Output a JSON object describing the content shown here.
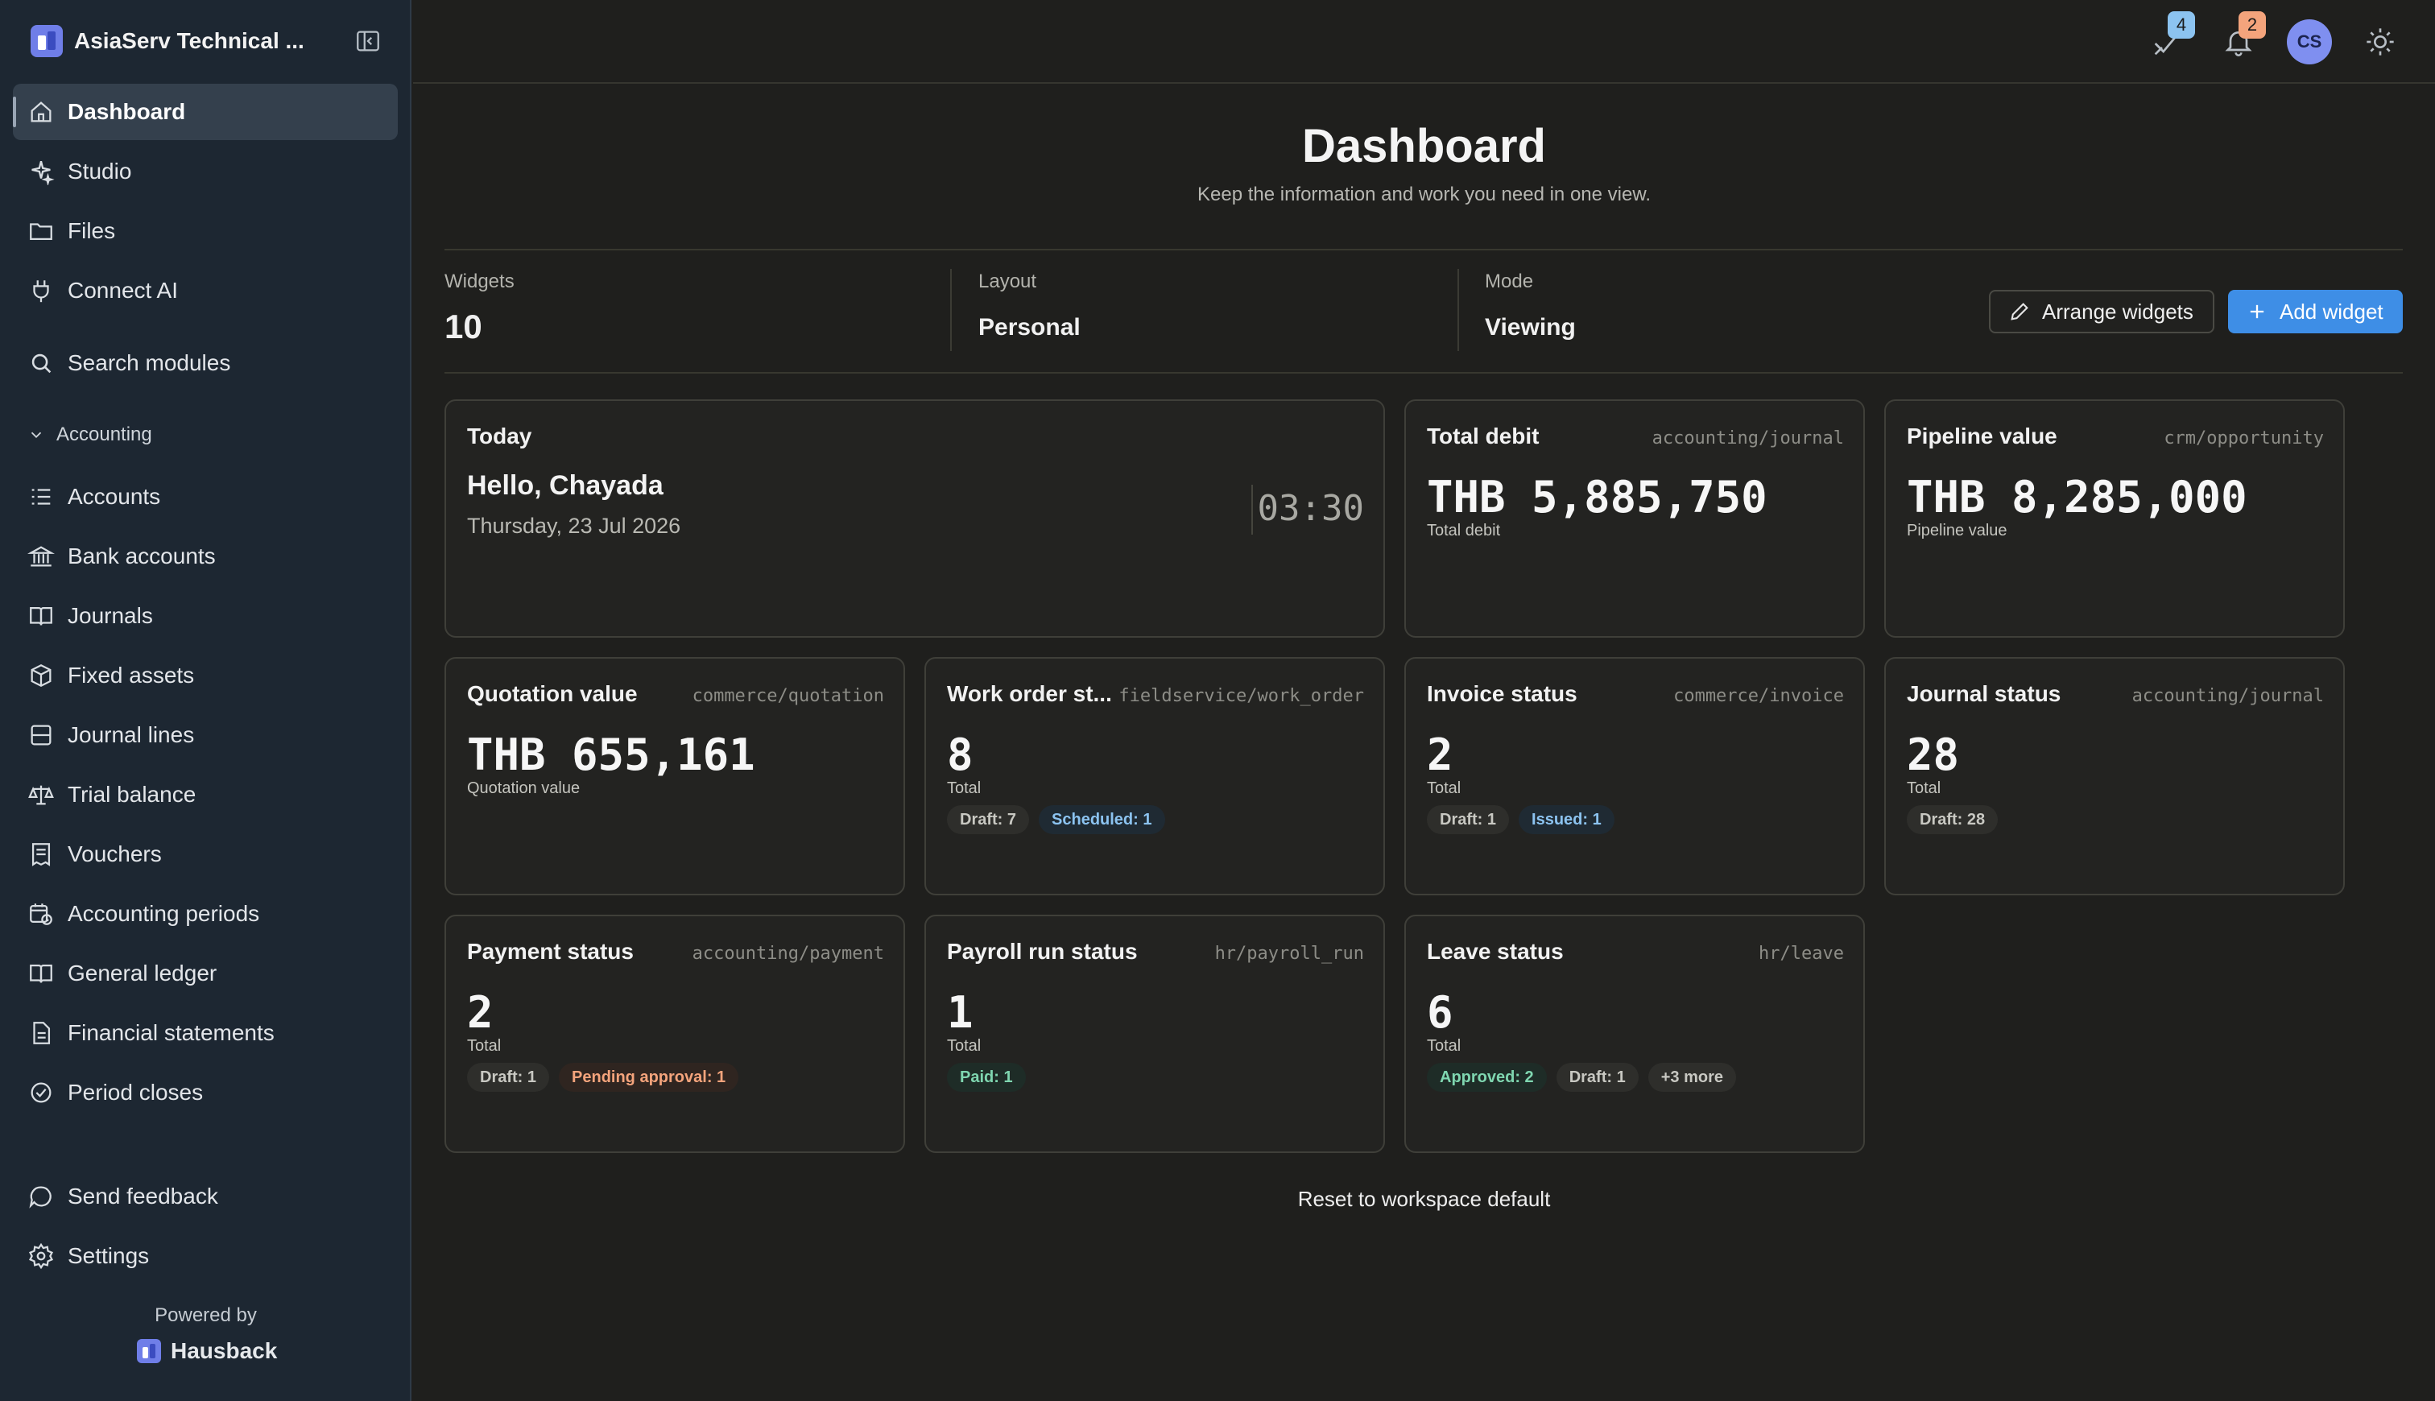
{
  "app": {
    "name": "AsiaServ Technical ..."
  },
  "sidebar": {
    "main_items": [
      {
        "label": "Dashboard",
        "icon": "home-icon",
        "active": true
      },
      {
        "label": "Studio",
        "icon": "sparkle-icon"
      },
      {
        "label": "Files",
        "icon": "folder-icon"
      },
      {
        "label": "Connect AI",
        "icon": "plug-icon"
      }
    ],
    "search_label": "Search modules",
    "section": {
      "label": "Accounting",
      "expanded": true
    },
    "accounting_items": [
      {
        "label": "Accounts",
        "icon": "list-icon"
      },
      {
        "label": "Bank accounts",
        "icon": "bank-icon"
      },
      {
        "label": "Journals",
        "icon": "book-icon"
      },
      {
        "label": "Fixed assets",
        "icon": "box-icon"
      },
      {
        "label": "Journal lines",
        "icon": "table-icon"
      },
      {
        "label": "Trial balance",
        "icon": "scale-icon"
      },
      {
        "label": "Vouchers",
        "icon": "receipt-icon"
      },
      {
        "label": "Accounting periods",
        "icon": "calendar-clock-icon"
      },
      {
        "label": "General ledger",
        "icon": "book-open-icon"
      },
      {
        "label": "Financial statements",
        "icon": "document-icon"
      },
      {
        "label": "Period closes",
        "icon": "check-circle-icon"
      }
    ],
    "footer_items": [
      {
        "label": "Send feedback",
        "icon": "chat-icon"
      },
      {
        "label": "Settings",
        "icon": "gear-icon"
      }
    ],
    "powered_by": "Powered by",
    "powered_brand": "Hausback"
  },
  "topbar": {
    "feedback_badge": "4",
    "notification_badge": "2",
    "avatar_initials": "CS"
  },
  "page": {
    "title": "Dashboard",
    "subtitle": "Keep the information and work you need in one view."
  },
  "stats": {
    "widgets_label": "Widgets",
    "widgets_value": "10",
    "layout_label": "Layout",
    "layout_value": "Personal",
    "mode_label": "Mode",
    "mode_value": "Viewing"
  },
  "actions": {
    "arrange": "Arrange widgets",
    "add": "Add widget",
    "reset": "Reset to workspace default"
  },
  "widgets": {
    "today": {
      "title": "Today",
      "greeting": "Hello, Chayada",
      "date": "Thursday, 23 Jul 2026",
      "time": "03:30"
    },
    "total_debit": {
      "title": "Total debit",
      "path": "accounting/journal",
      "value": "THB 5,885,750",
      "caption": "Total debit"
    },
    "pipeline_value": {
      "title": "Pipeline value",
      "path": "crm/opportunity",
      "value": "THB 8,285,000",
      "caption": "Pipeline value"
    },
    "quotation_value": {
      "title": "Quotation value",
      "path": "commerce/quotation",
      "value": "THB 655,161",
      "caption": "Quotation value"
    },
    "work_order": {
      "title": "Work order st...",
      "path": "fieldservice/work_order",
      "value": "8",
      "caption": "Total",
      "chips": [
        "Draft: 7",
        "Scheduled: 1"
      ]
    },
    "invoice": {
      "title": "Invoice status",
      "path": "commerce/invoice",
      "value": "2",
      "caption": "Total",
      "chips": [
        "Draft: 1",
        "Issued: 1"
      ]
    },
    "journal": {
      "title": "Journal status",
      "path": "accounting/journal",
      "value": "28",
      "caption": "Total",
      "chips": [
        "Draft: 28"
      ]
    },
    "payment": {
      "title": "Payment status",
      "path": "accounting/payment",
      "value": "2",
      "caption": "Total",
      "chips": [
        "Draft: 1",
        "Pending approval: 1"
      ]
    },
    "payroll": {
      "title": "Payroll run status",
      "path": "hr/payroll_run",
      "value": "1",
      "caption": "Total",
      "chips": [
        "Paid: 1"
      ]
    },
    "leave": {
      "title": "Leave status",
      "path": "hr/leave",
      "value": "6",
      "caption": "Total",
      "chips": [
        "Approved: 2",
        "Draft: 1",
        "+3 more"
      ]
    }
  },
  "colors": {
    "background": "#1f1f1d",
    "sidebar": "#1d2732",
    "primary": "#3e8ee6",
    "feedback_badge": "#8cc3f0",
    "notification_badge": "#f4a47c",
    "avatar": "#7f8ff0"
  }
}
